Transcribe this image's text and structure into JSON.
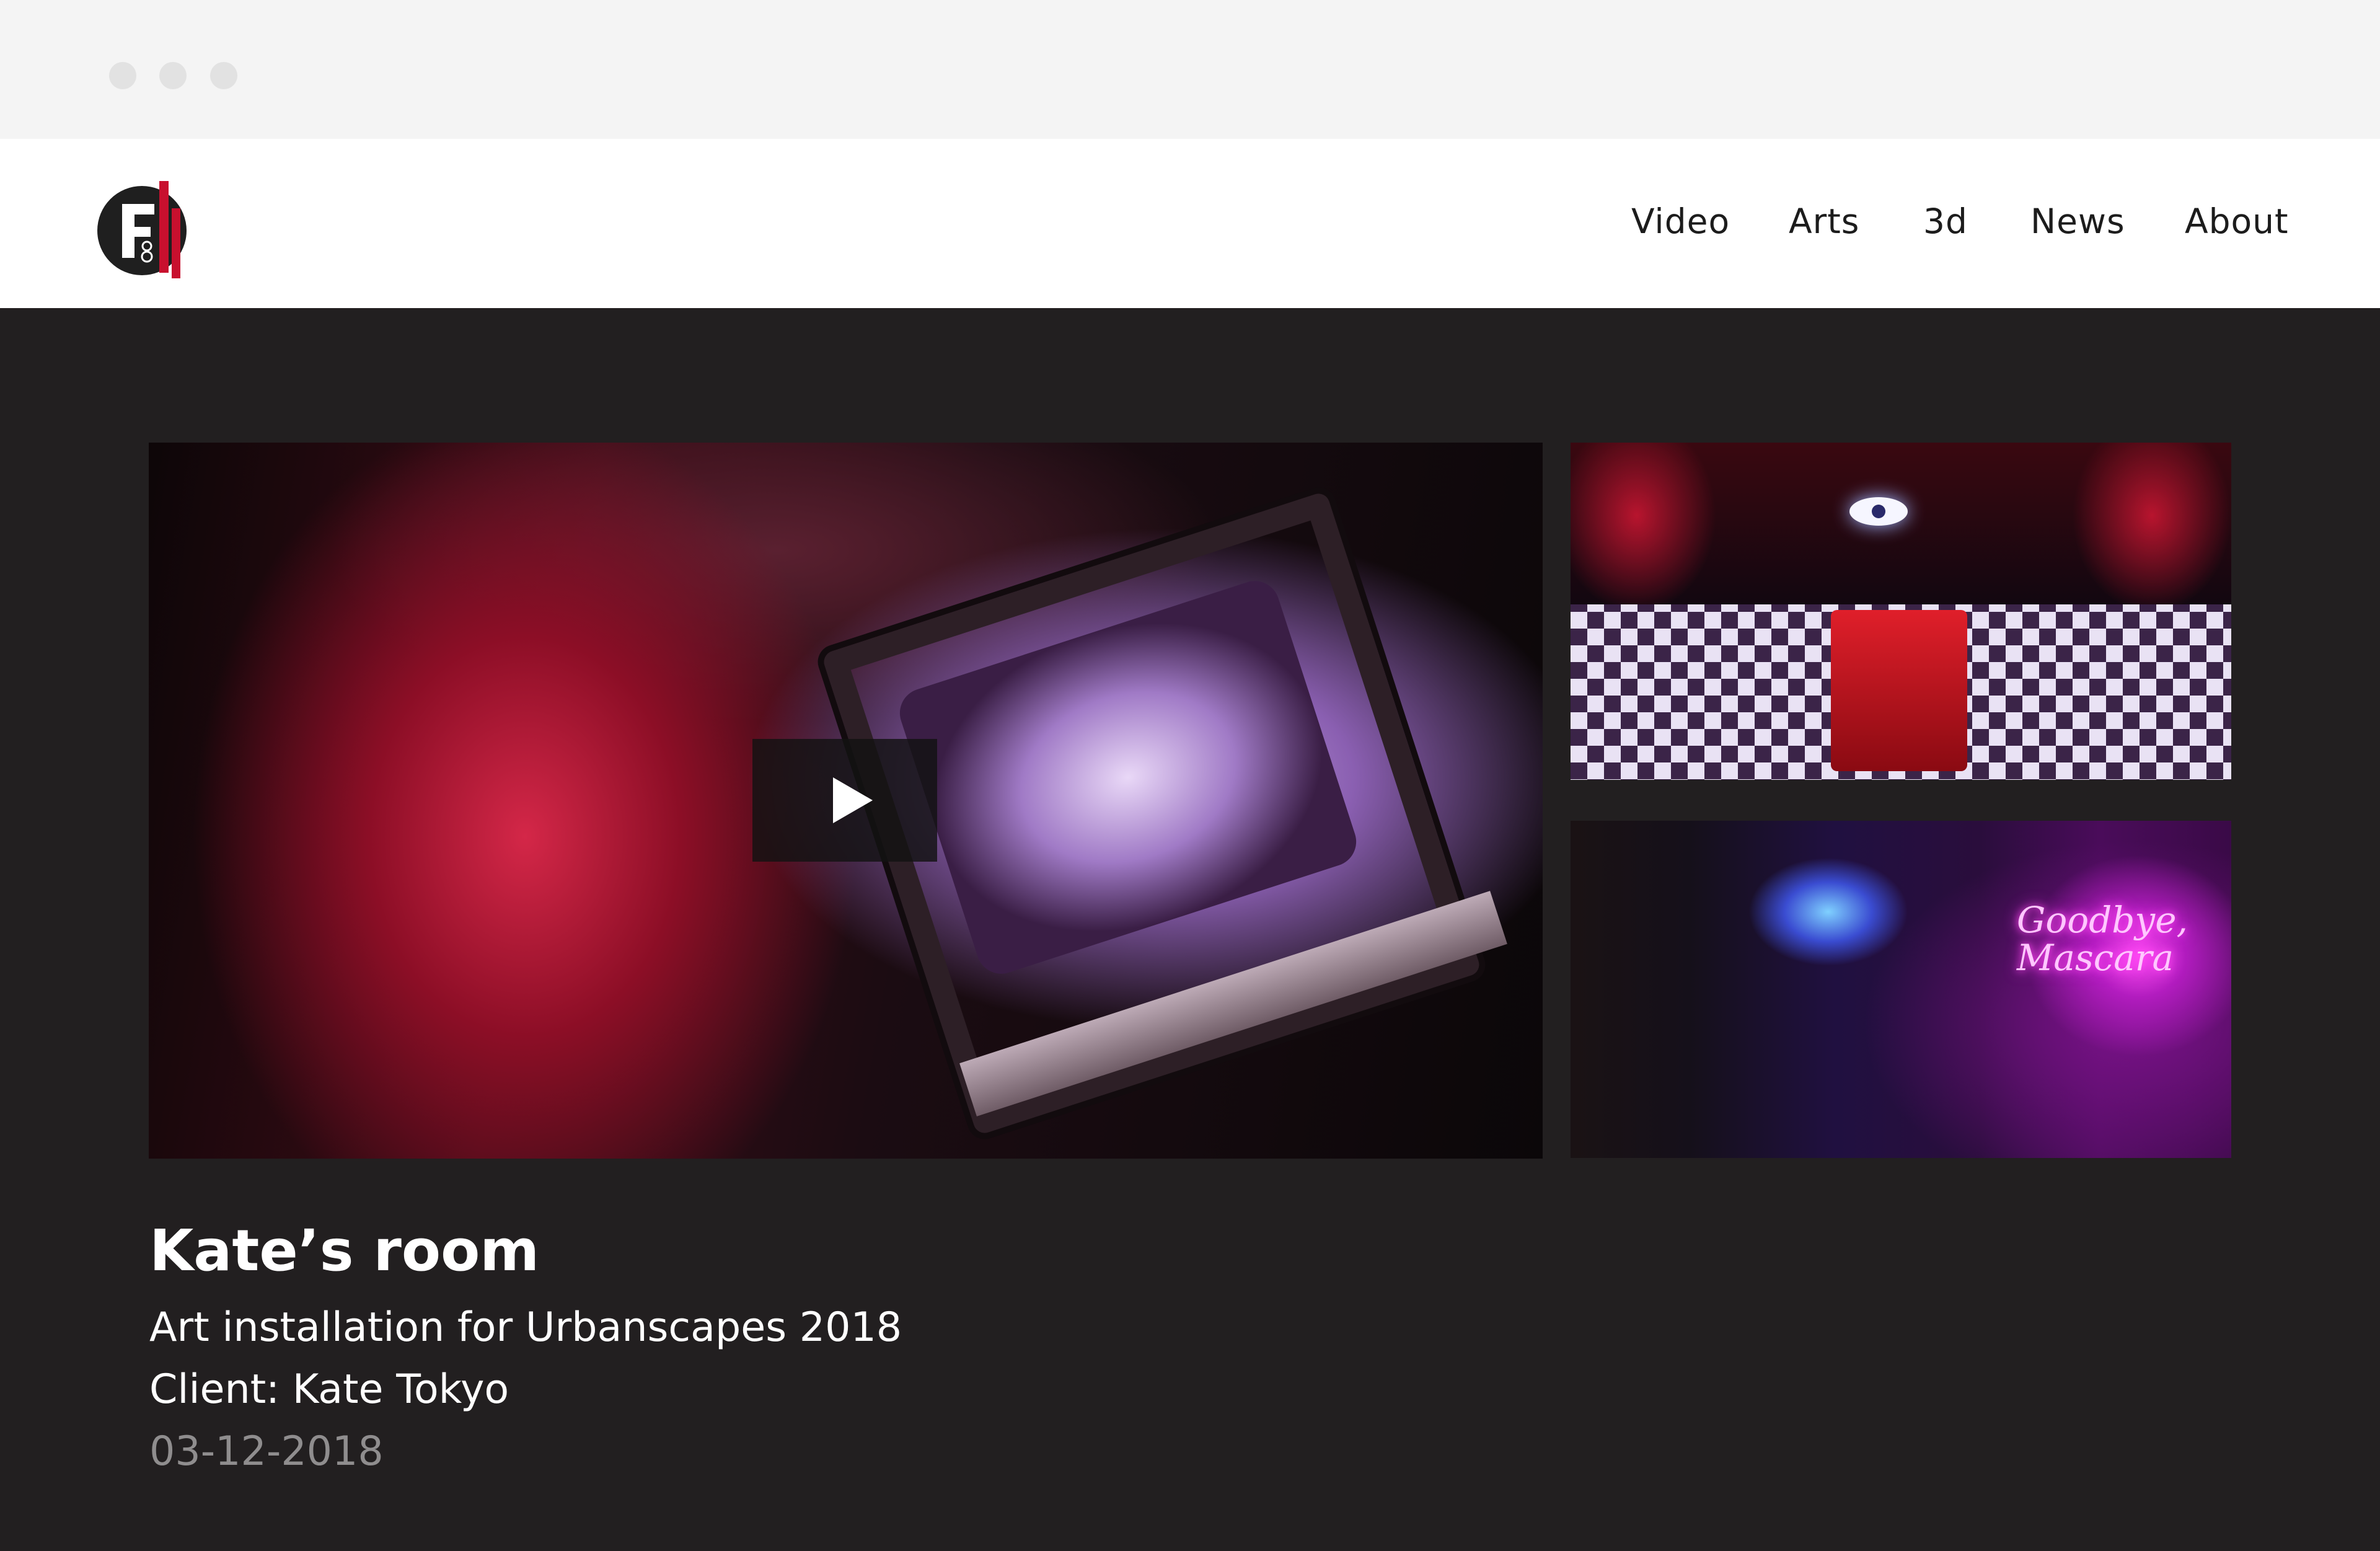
{
  "nav": {
    "logo_label": "F8",
    "items": [
      {
        "label": "Video"
      },
      {
        "label": "Arts"
      },
      {
        "label": "3d"
      },
      {
        "label": "News"
      },
      {
        "label": "About"
      }
    ]
  },
  "gallery": {
    "thumb_bottom_neon": "Goodbye, Mascara"
  },
  "project": {
    "title": "Kate’s room",
    "subtitle": "Art installation for Urbanscapes 2018",
    "client": "Client: Kate Tokyo",
    "date": "03-12-2018"
  },
  "colors": {
    "page_background": "#221f20",
    "nav_background": "#ffffff",
    "chrome_background": "#f4f4f4",
    "logo_red": "#c8102e",
    "date_text": "#8f8d8e"
  },
  "icons": [
    "window-control-dot",
    "play-icon",
    "brand-logo"
  ]
}
